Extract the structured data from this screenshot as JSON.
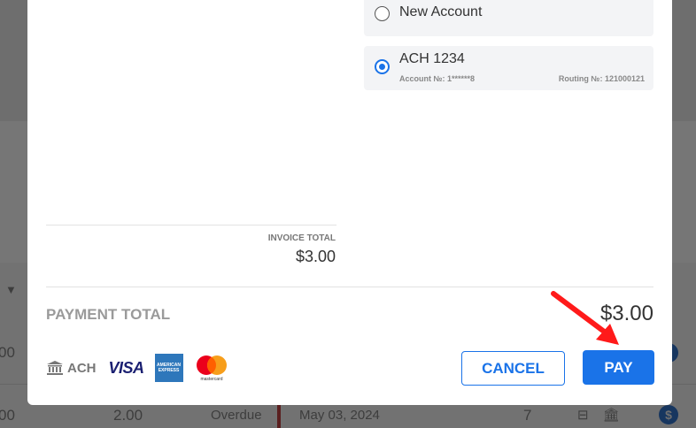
{
  "payment_options": [
    {
      "label": "New Account",
      "selected": false
    },
    {
      "label": "ACH 1234",
      "selected": true,
      "account_no": "Account №: 1******8",
      "routing_no": "Routing №: 121000121"
    }
  ],
  "invoice": {
    "total_label": "INVOICE TOTAL",
    "total_value": "$3.00"
  },
  "payment_total": {
    "label": "PAYMENT TOTAL",
    "value": "$3.00"
  },
  "methods": {
    "bank_icon": "bank-icon",
    "ach_label": "ACH",
    "visa_label": "VISA",
    "amex_label": "AMERICAN EXPRESS",
    "mastercard_label": "mastercard"
  },
  "buttons": {
    "cancel": "CANCEL",
    "pay": "PAY"
  },
  "background_table": {
    "row1": {
      "amount": "00"
    },
    "row2": {
      "amount_left": "00",
      "amount": "2.00",
      "status": "Overdue",
      "date": "May 03, 2024",
      "count": "7",
      "icons": "⊟ 🏛",
      "dollar": "$"
    }
  },
  "colors": {
    "accent": "#1a73e8",
    "annotation_arrow": "#ff1a1a"
  }
}
